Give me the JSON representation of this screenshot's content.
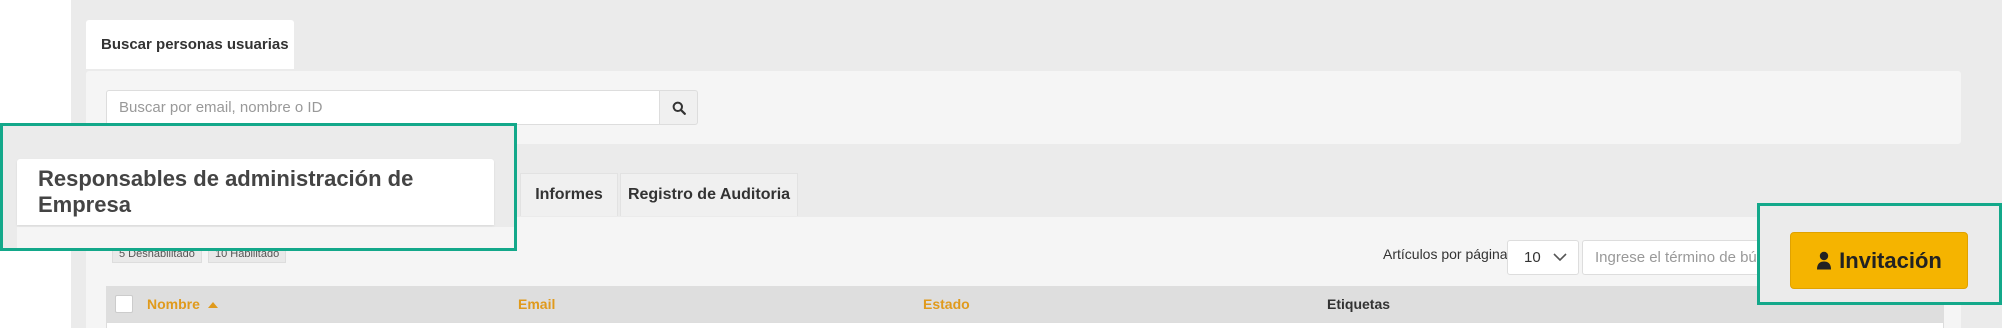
{
  "search_section": {
    "tab_label": "Buscar personas usuarias",
    "input_placeholder": "Buscar por email, nombre o ID"
  },
  "tabs": [
    {
      "label": "Responsables de administración de Empresa",
      "active": true
    },
    {
      "label": "Informes",
      "active": false
    },
    {
      "label": "Registro de Auditoria",
      "active": false
    }
  ],
  "status_badges": [
    {
      "label": "5 Deshabilitado"
    },
    {
      "label": "10 Habilitado"
    }
  ],
  "pagination": {
    "per_page_label": "Artículos por página:",
    "per_page_value": "10"
  },
  "table_search": {
    "placeholder": "Ingrese el término de búsqueda"
  },
  "table": {
    "columns": [
      {
        "label": "Nombre",
        "sorted": "asc"
      },
      {
        "label": "Email"
      },
      {
        "label": "Estado"
      },
      {
        "label": "Etiquetas"
      }
    ]
  },
  "invite_button": {
    "label": "Invitación",
    "icon": "user-icon"
  },
  "colors": {
    "accent_yellow": "#f5b400",
    "sortable_header": "#e09a1c",
    "highlight_frame": "#13a88a",
    "page_background": "#ebebeb"
  }
}
